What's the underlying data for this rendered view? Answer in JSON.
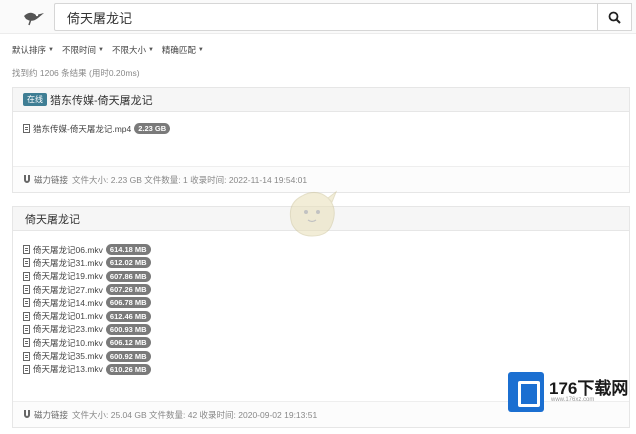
{
  "search": {
    "value": "倚天屠龙记"
  },
  "filters": [
    {
      "label": "默认排序"
    },
    {
      "label": "不限时间"
    },
    {
      "label": "不限大小"
    },
    {
      "label": "精确匹配"
    }
  ],
  "summary": "找到约 1206 条结果 (用时0.20ms)",
  "results": [
    {
      "badge": "在线",
      "title": "猎东传媒-倚天屠龙记",
      "files": [
        {
          "name": "猎东传媒-倚天屠龙记.mp4",
          "size": "2.23 GB"
        }
      ],
      "footer": {
        "link": "磁力链接",
        "meta": "文件大小: 2.23 GB 文件数量: 1 收录时间: 2022-11-14 19:54:01"
      }
    },
    {
      "title": "倚天屠龙记",
      "files": [
        {
          "name": "倚天屠龙记06.mkv",
          "size": "614.18 MB"
        },
        {
          "name": "倚天屠龙记31.mkv",
          "size": "612.02 MB"
        },
        {
          "name": "倚天屠龙记19.mkv",
          "size": "607.86 MB"
        },
        {
          "name": "倚天屠龙记27.mkv",
          "size": "607.26 MB"
        },
        {
          "name": "倚天屠龙记14.mkv",
          "size": "606.78 MB"
        },
        {
          "name": "倚天屠龙记01.mkv",
          "size": "612.46 MB"
        },
        {
          "name": "倚天屠龙记23.mkv",
          "size": "600.93 MB"
        },
        {
          "name": "倚天屠龙记10.mkv",
          "size": "606.12 MB"
        },
        {
          "name": "倚天屠龙记35.mkv",
          "size": "600.92 MB"
        },
        {
          "name": "倚天屠龙记13.mkv",
          "size": "610.26 MB"
        }
      ],
      "footer": {
        "link": "磁力链接",
        "meta": "文件大小: 25.04 GB 文件数量: 42 收录时间: 2020-09-02 19:13:51"
      }
    }
  ],
  "watermark": {
    "brand": "176下载网",
    "url": "www.176xz.com"
  },
  "colors": {
    "badge_online": "#3f7e94",
    "size_badge": "#7a7a7a",
    "watermark_blue": "#1b6fd1"
  }
}
